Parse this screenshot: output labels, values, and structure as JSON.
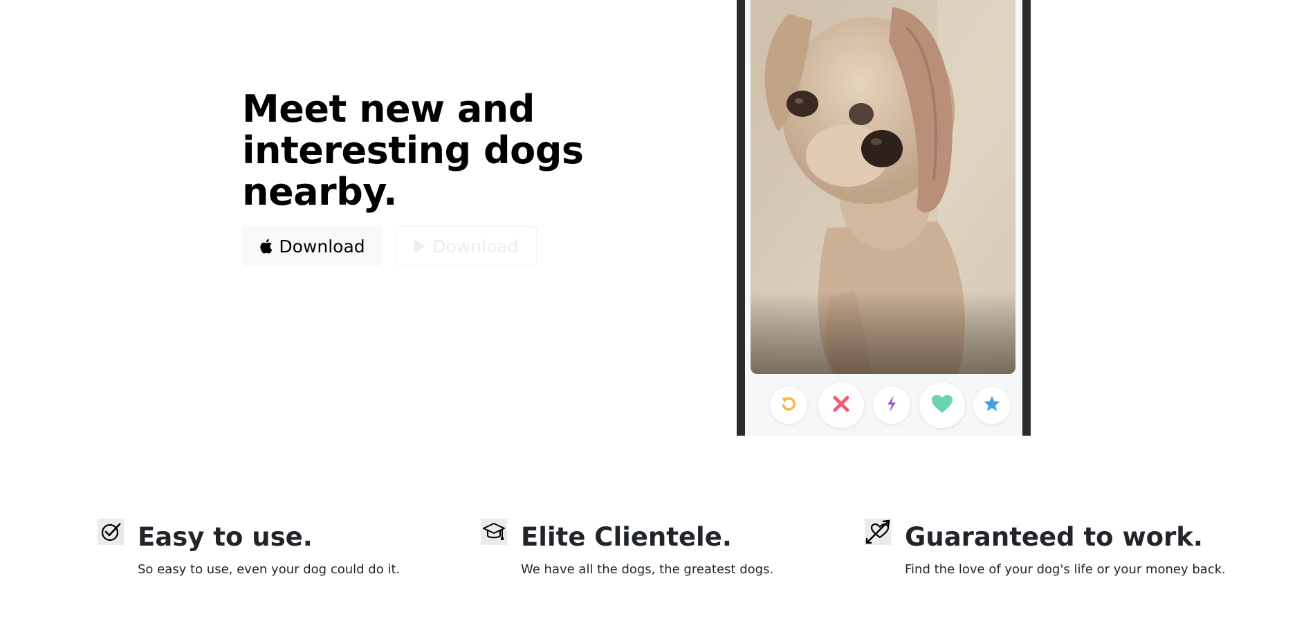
{
  "hero": {
    "title": "Meet new and interesting dogs nearby.",
    "apple_download_label": "Download",
    "play_download_label": "Download",
    "apple_icon": "apple-icon",
    "play_icon": "play-store-icon"
  },
  "phone": {
    "photo_subject": "dog",
    "actions": [
      {
        "name": "rewind",
        "icon": "rewind-icon",
        "color": "#f5b748"
      },
      {
        "name": "nope",
        "icon": "close-icon",
        "color": "#ec5e6f"
      },
      {
        "name": "boost",
        "icon": "lightning-icon",
        "color": "#915dd1"
      },
      {
        "name": "like",
        "icon": "heart-icon",
        "color": "#6bd3b2"
      },
      {
        "name": "super-like",
        "icon": "star-icon",
        "color": "#42a0de"
      }
    ]
  },
  "features": [
    {
      "icon": "check-circle-icon",
      "title": "Easy to use.",
      "description": "So easy to use, even your dog could do it."
    },
    {
      "icon": "graduation-cap-icon",
      "title": "Elite Clientele.",
      "description": "We have all the dogs, the greatest dogs."
    },
    {
      "icon": "heart-arrow-icon",
      "title": "Guaranteed to work.",
      "description": "Find the love of your dog's life or your money back."
    }
  ]
}
